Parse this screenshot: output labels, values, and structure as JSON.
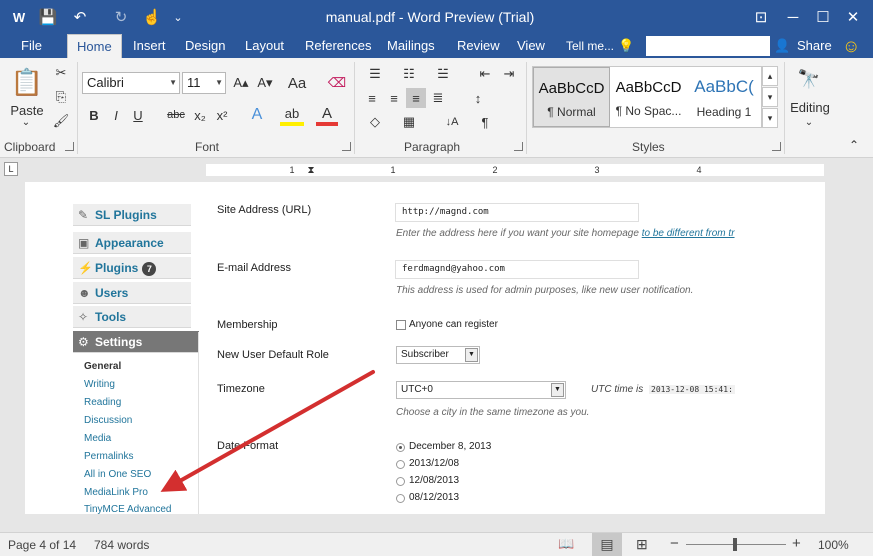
{
  "titlebar": {
    "title": "manual.pdf - Word Preview (Trial)",
    "app_icon": "W",
    "save_icon": "💾",
    "undo_icon": "↶",
    "redo_icon": "↻",
    "touch_icon": "☝",
    "customize_icon": "⌄",
    "restore_icon": "⊡",
    "minimize_icon": "─",
    "maximize_icon": "☐",
    "close_icon": "✕"
  },
  "tabs": {
    "file": "File",
    "home": "Home",
    "insert": "Insert",
    "design": "Design",
    "layout": "Layout",
    "references": "References",
    "mailings": "Mailings",
    "review": "Review",
    "view": "View",
    "tell_me": "Tell me...",
    "tell_me_icon": "💡",
    "share_icon": "👤",
    "share": "Share",
    "smiley_icon": "☺"
  },
  "ribbon": {
    "clipboard": {
      "paste": "Paste",
      "paste_arrow": "⌄",
      "paste_icon": "📋",
      "cut_icon": "✂",
      "copy_icon": "⎘",
      "format_painter_icon": "🖌",
      "label": "Clipboard"
    },
    "font": {
      "name": "Calibri",
      "size": "11",
      "grow_icon": "A▴",
      "shrink_icon": "A▾",
      "change_case": "Aa",
      "clear_icon": "⌫",
      "bold": "B",
      "italic": "I",
      "underline": "U",
      "strike": "abc",
      "subscript": "x₂",
      "superscript": "x²",
      "effects_icon": "A",
      "highlight_icon": "ab",
      "font_color_icon": "A",
      "label": "Font"
    },
    "paragraph": {
      "bullets_icon": "☰",
      "numbering_icon": "☷",
      "multilevel_icon": "☱",
      "decrease_indent_icon": "⇤",
      "increase_indent_icon": "⇥",
      "align_left_icon": "≡",
      "align_center_icon": "≡",
      "align_right_icon": "≡",
      "justify_icon": "≣",
      "line_spacing_icon": "↕",
      "shading_icon": "◇",
      "borders_icon": "▦",
      "sort_icon": "↓A",
      "pilcrow_icon": "¶",
      "label": "Paragraph"
    },
    "styles": {
      "items": [
        {
          "preview": "AaBbCcD",
          "name": "¶ Normal"
        },
        {
          "preview": "AaBbCcD",
          "name": "¶ No Spac..."
        },
        {
          "preview": "AaBbC(",
          "name": "Heading 1"
        }
      ],
      "scroll_up": "▴",
      "scroll_down": "▾",
      "more": "▾",
      "label": "Styles"
    },
    "editing": {
      "icon": "🔭",
      "label": "Editing",
      "arrow": "⌄"
    },
    "collapse_icon": "⌃"
  },
  "ruler": {
    "numbers": [
      "1",
      "1",
      "2",
      "3",
      "4"
    ],
    "tab_selector": "L"
  },
  "document": {
    "wp_menu": [
      {
        "icon": "✎",
        "label": "SL Plugins"
      },
      {
        "icon": "▣",
        "label": "Appearance"
      },
      {
        "icon": "⚡",
        "label": "Plugins",
        "badge": "7"
      },
      {
        "icon": "☻",
        "label": "Users"
      },
      {
        "icon": "✧",
        "label": "Tools"
      },
      {
        "icon": "⚙",
        "label": "Settings"
      }
    ],
    "settings_sub": [
      "General",
      "Writing",
      "Reading",
      "Discussion",
      "Media",
      "Permalinks",
      "All in One SEO",
      "MediaLink Pro",
      "TinyMCE Advanced"
    ],
    "site_address": {
      "label": "Site Address (URL)",
      "value": "http://magnd.com",
      "desc": "Enter the address here if you want your site homepage",
      "desc_link": "to be different from tr"
    },
    "email": {
      "label": "E-mail Address",
      "value": "ferdmagnd@yahoo.com",
      "desc": "This address is used for admin purposes, like new user notification."
    },
    "membership": {
      "label": "Membership",
      "option": "Anyone can register"
    },
    "role": {
      "label": "New User Default Role",
      "value": "Subscriber"
    },
    "timezone": {
      "label": "Timezone",
      "value": "UTC+0",
      "utc_label": "UTC time is",
      "utc_value": "2013-12-08 15:41:",
      "desc": "Choose a city in the same timezone as you."
    },
    "date_format": {
      "label": "Date Format",
      "options": [
        "December 8, 2013",
        "2013/12/08",
        "12/08/2013",
        "08/12/2013"
      ]
    }
  },
  "status": {
    "page": "Page 4 of 14",
    "words": "784 words",
    "read_icon": "📖",
    "print_icon": "▤",
    "web_icon": "⊞",
    "zoom_out": "−",
    "zoom_in": "+",
    "zoom": "100%"
  },
  "colors": {
    "accent": "#2b579a",
    "wp_link": "#21759b",
    "arrow": "#d32f2f"
  }
}
